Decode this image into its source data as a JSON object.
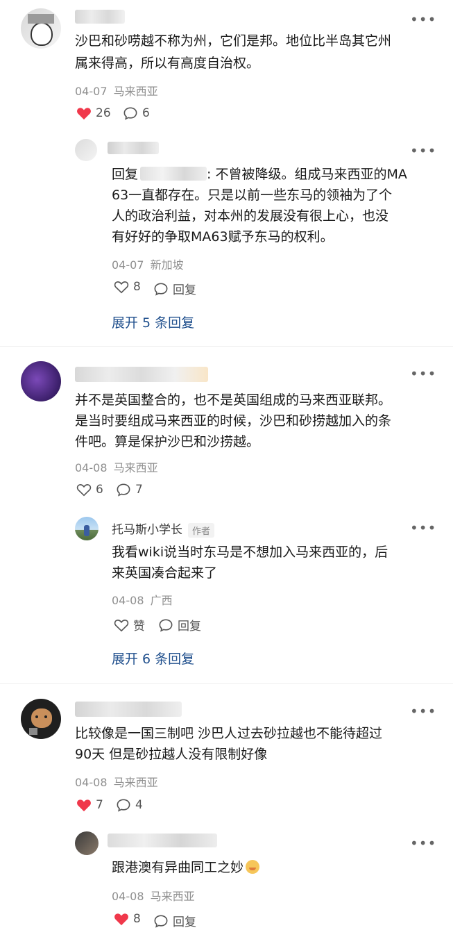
{
  "icons": {
    "more": "more-dots-icon",
    "like": "heart-icon",
    "reply": "comment-bubble-icon"
  },
  "colors": {
    "liked": "#f0384b",
    "link": "#1e4e8c",
    "meta": "#8f8f8f"
  },
  "comments": [
    {
      "text_lines": [
        "沙巴和砂唠越不称为州，它们是邦。地位比半岛其它州",
        "属来得高，所以有高度自治权。"
      ],
      "date": "04-07",
      "location": "马来西亚",
      "likes": "26",
      "liked": true,
      "replies": "6",
      "reply": {
        "text_lines": [
          "回复",
          ": 不曾被降级。组成马来西亚的MA",
          "63一直都存在。只是以前一些东马的领袖为了个",
          "人的政治利益，对本州的发展没有很上心，也没",
          "有好好的争取MA63赋予东马的权利。"
        ],
        "date": "04-07",
        "location": "新加坡",
        "likes": "8",
        "reply_label": "回复"
      },
      "expand": "展开 5 条回复"
    },
    {
      "text_lines": [
        "并不是英国整合的，也不是英国组成的马来西亚联邦。",
        "是当时要组成马来西亚的时候，沙巴和砂捞越加入的条",
        "件吧。算是保护沙巴和沙捞越。"
      ],
      "date": "04-08",
      "location": "马来西亚",
      "likes": "6",
      "replies": "7",
      "reply": {
        "name": "托马斯小学长",
        "tag": "作者",
        "text_lines": [
          "我看wiki说当时东马是不想加入马来西亚的，后",
          "来英国凑合起来了"
        ],
        "date": "04-08",
        "location": "广西",
        "like_label": "赞",
        "reply_label": "回复"
      },
      "expand": "展开 6 条回复"
    },
    {
      "text_lines": [
        "比较像是一国三制吧 沙巴人过去砂拉越也不能待超过",
        "90天 但是砂拉越人没有限制好像"
      ],
      "date": "04-08",
      "location": "马来西亚",
      "likes": "7",
      "liked": true,
      "replies": "4",
      "reply": {
        "text_lines": [
          "跟港澳有异曲同工之妙"
        ],
        "date": "04-08",
        "location": "马来西亚",
        "likes": "8",
        "reply_label": "回复"
      }
    }
  ]
}
